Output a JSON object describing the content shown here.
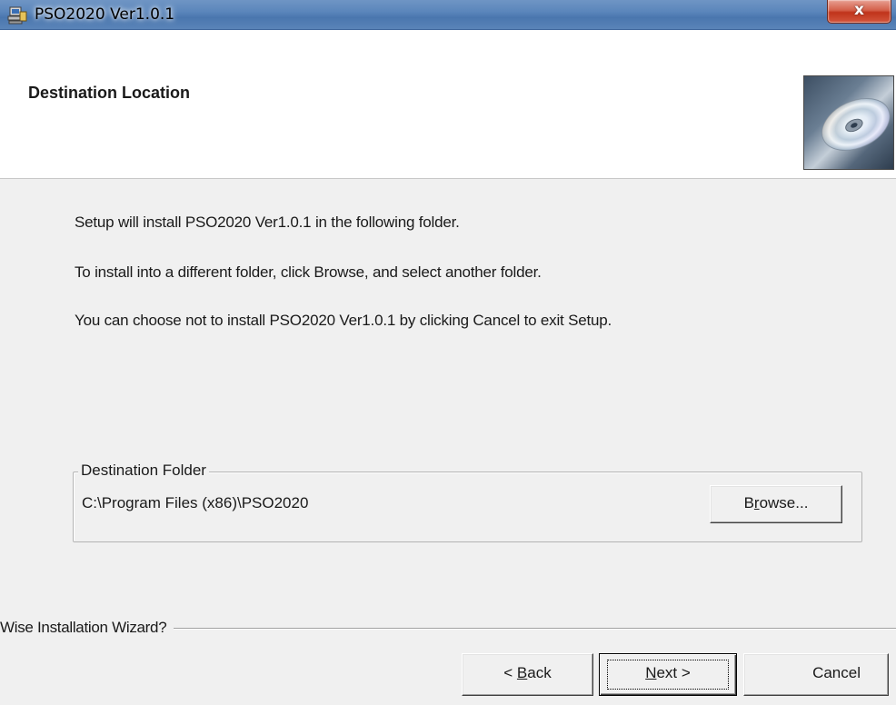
{
  "window": {
    "title": "PSO2020 Ver1.0.1",
    "close_glyph": "x",
    "icon": "setup-computer-icon",
    "accent_color": "#5b86bb",
    "close_color": "#c0341b"
  },
  "header": {
    "title": "Destination Location",
    "image": "cd-disc-image"
  },
  "body": {
    "lines": [
      "Setup will install PSO2020 Ver1.0.1 in the following folder.",
      "To install into a different folder, click Browse, and select another folder.",
      "You can choose not to install PSO2020 Ver1.0.1 by clicking Cancel to exit Setup."
    ]
  },
  "destination": {
    "group_label": "Destination Folder",
    "path": "C:\\Program Files (x86)\\PSO2020",
    "browse_label": "Browse...",
    "browse_access_key": "r"
  },
  "footer": {
    "wizard_label": "Wise Installation Wizard?",
    "back_label": "< Back",
    "back_access_key": "B",
    "next_label": "Next >",
    "next_access_key": "N",
    "cancel_label": "Cancel"
  }
}
